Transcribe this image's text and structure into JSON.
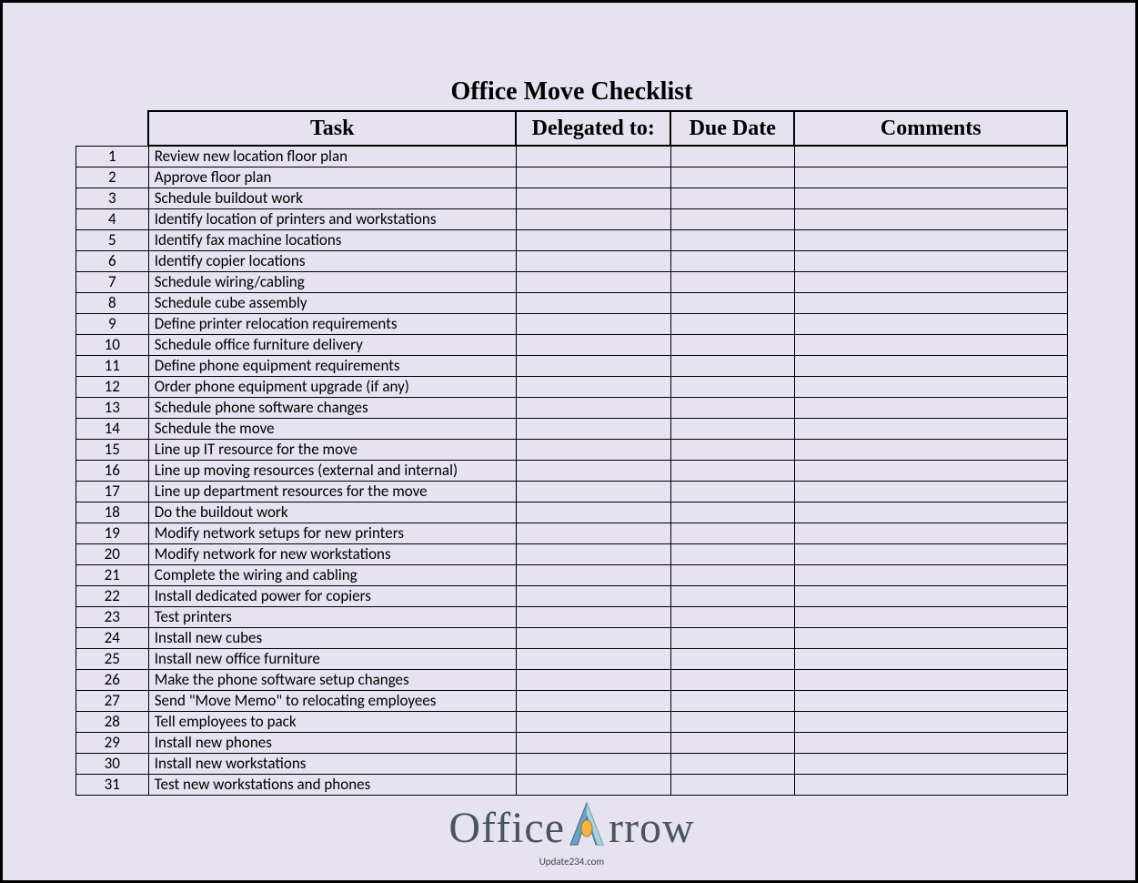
{
  "title": "Office Move Checklist",
  "columns": {
    "task": "Task",
    "delegated": "Delegated to:",
    "due": "Due Date",
    "comments": "Comments"
  },
  "rows": [
    {
      "n": "1",
      "task": "Review new location floor plan",
      "delegated": "",
      "due": "",
      "comments": ""
    },
    {
      "n": "2",
      "task": "Approve floor plan",
      "delegated": "",
      "due": "",
      "comments": ""
    },
    {
      "n": "3",
      "task": "Schedule buildout work",
      "delegated": "",
      "due": "",
      "comments": ""
    },
    {
      "n": "4",
      "task": "Identify location of printers and workstations",
      "delegated": "",
      "due": "",
      "comments": ""
    },
    {
      "n": "5",
      "task": "Identify fax machine locations",
      "delegated": "",
      "due": "",
      "comments": ""
    },
    {
      "n": "6",
      "task": "Identify copier locations",
      "delegated": "",
      "due": "",
      "comments": ""
    },
    {
      "n": "7",
      "task": "Schedule wiring/cabling",
      "delegated": "",
      "due": "",
      "comments": ""
    },
    {
      "n": "8",
      "task": "Schedule cube assembly",
      "delegated": "",
      "due": "",
      "comments": ""
    },
    {
      "n": "9",
      "task": "Define printer relocation requirements",
      "delegated": "",
      "due": "",
      "comments": ""
    },
    {
      "n": "10",
      "task": "Schedule office furniture delivery",
      "delegated": "",
      "due": "",
      "comments": ""
    },
    {
      "n": "11",
      "task": "Define phone equipment requirements",
      "delegated": "",
      "due": "",
      "comments": ""
    },
    {
      "n": "12",
      "task": "Order phone equipment upgrade (if any)",
      "delegated": "",
      "due": "",
      "comments": ""
    },
    {
      "n": "13",
      "task": "Schedule phone software changes",
      "delegated": "",
      "due": "",
      "comments": ""
    },
    {
      "n": "14",
      "task": "Schedule the move",
      "delegated": "",
      "due": "",
      "comments": ""
    },
    {
      "n": "15",
      "task": "Line up IT resource for the move",
      "delegated": "",
      "due": "",
      "comments": ""
    },
    {
      "n": "16",
      "task": "Line up moving resources (external and internal)",
      "delegated": "",
      "due": "",
      "comments": ""
    },
    {
      "n": "17",
      "task": "Line up department resources for the move",
      "delegated": "",
      "due": "",
      "comments": ""
    },
    {
      "n": "18",
      "task": "Do the buildout work",
      "delegated": "",
      "due": "",
      "comments": ""
    },
    {
      "n": "19",
      "task": "Modify network setups for new printers",
      "delegated": "",
      "due": "",
      "comments": ""
    },
    {
      "n": "20",
      "task": "Modify network for new workstations",
      "delegated": "",
      "due": "",
      "comments": ""
    },
    {
      "n": "21",
      "task": "Complete the wiring and cabling",
      "delegated": "",
      "due": "",
      "comments": ""
    },
    {
      "n": "22",
      "task": "Install dedicated power for copiers",
      "delegated": "",
      "due": "",
      "comments": ""
    },
    {
      "n": "23",
      "task": "Test printers",
      "delegated": "",
      "due": "",
      "comments": ""
    },
    {
      "n": "24",
      "task": "Install new cubes",
      "delegated": "",
      "due": "",
      "comments": ""
    },
    {
      "n": "25",
      "task": "Install new office furniture",
      "delegated": "",
      "due": "",
      "comments": ""
    },
    {
      "n": "26",
      "task": "Make the phone software setup changes",
      "delegated": "",
      "due": "",
      "comments": ""
    },
    {
      "n": "27",
      "task": "Send \"Move Memo\" to relocating employees",
      "delegated": "",
      "due": "",
      "comments": ""
    },
    {
      "n": "28",
      "task": "Tell employees to pack",
      "delegated": "",
      "due": "",
      "comments": ""
    },
    {
      "n": "29",
      "task": "Install new phones",
      "delegated": "",
      "due": "",
      "comments": ""
    },
    {
      "n": "30",
      "task": "Install new workstations",
      "delegated": "",
      "due": "",
      "comments": ""
    },
    {
      "n": "31",
      "task": "Test new workstations and phones",
      "delegated": "",
      "due": "",
      "comments": ""
    }
  ],
  "logo": {
    "word1": "Office",
    "word2": "rrow"
  },
  "source": "Update234.com"
}
